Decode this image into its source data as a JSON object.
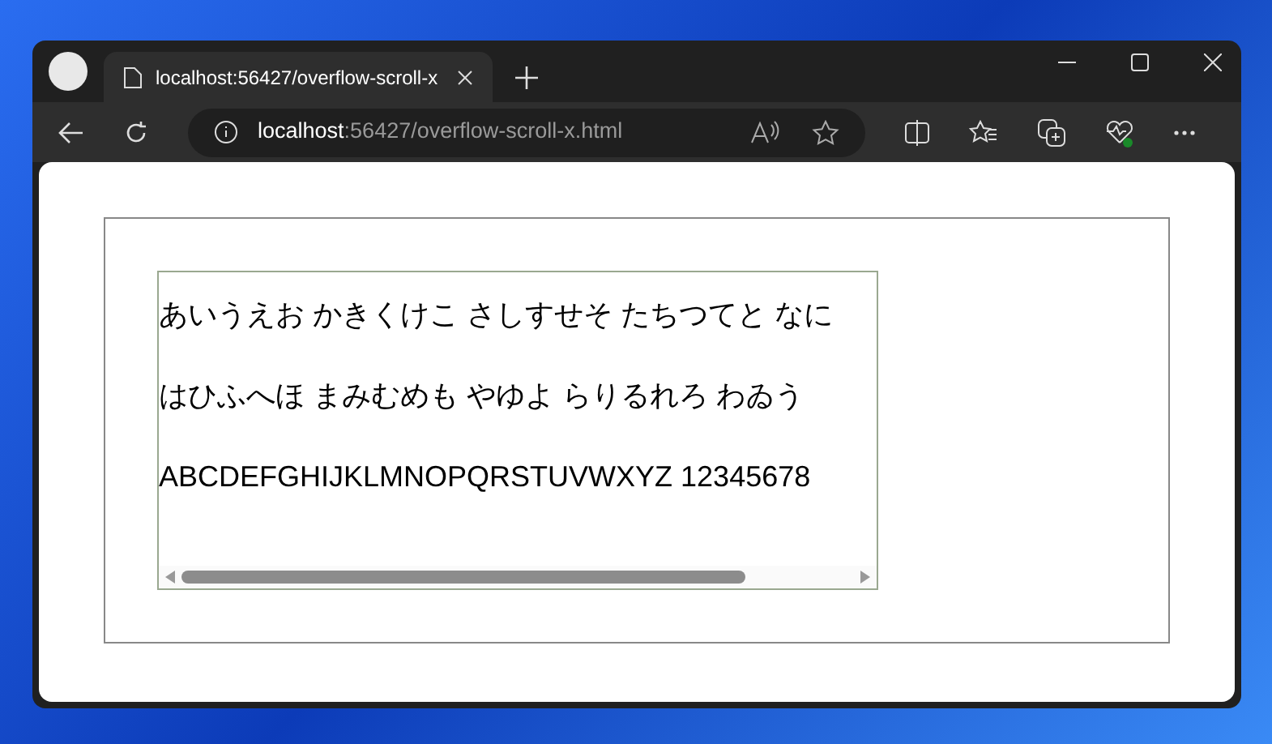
{
  "browser": {
    "tab": {
      "title": "localhost:56427/overflow-scroll-x",
      "selected": true
    },
    "address": {
      "host": "localhost",
      "path": ":56427/overflow-scroll-x.html"
    }
  },
  "page": {
    "scroll_box": {
      "lines": [
        "あいうえお かきくけこ さしすせそ たちつてと なに",
        "はひふへほ まみむめも やゆよ らりるれろ わゐう",
        "ABCDEFGHIJKLMNOPQRSTUVWXYZ 12345678"
      ]
    }
  }
}
